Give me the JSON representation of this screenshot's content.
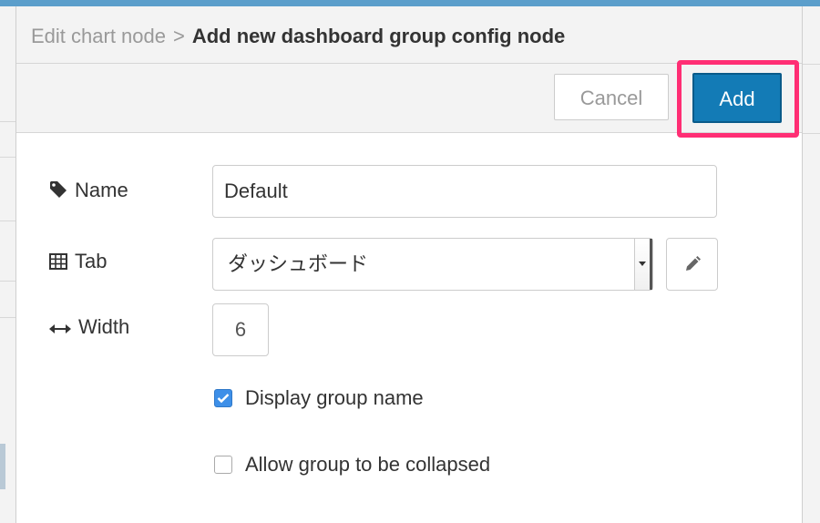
{
  "breadcrumb": {
    "parent": "Edit chart node",
    "separator": ">",
    "current": "Add new dashboard group config node"
  },
  "buttons": {
    "cancel": "Cancel",
    "add": "Add"
  },
  "form": {
    "name": {
      "label": "Name",
      "icon": "tag-icon",
      "value": "Default"
    },
    "tab": {
      "label": "Tab",
      "icon": "table-icon",
      "selected": "ダッシュボード"
    },
    "width": {
      "label": "Width",
      "icon": "arrows-h-icon",
      "value": "6"
    },
    "display_group_name": {
      "label": "Display group name",
      "checked": true
    },
    "allow_collapse": {
      "label": "Allow group to be collapsed",
      "checked": false
    }
  },
  "colors": {
    "accent": "#137bb6",
    "highlight": "#ff2e74",
    "checkbox": "#3d8fe8"
  }
}
